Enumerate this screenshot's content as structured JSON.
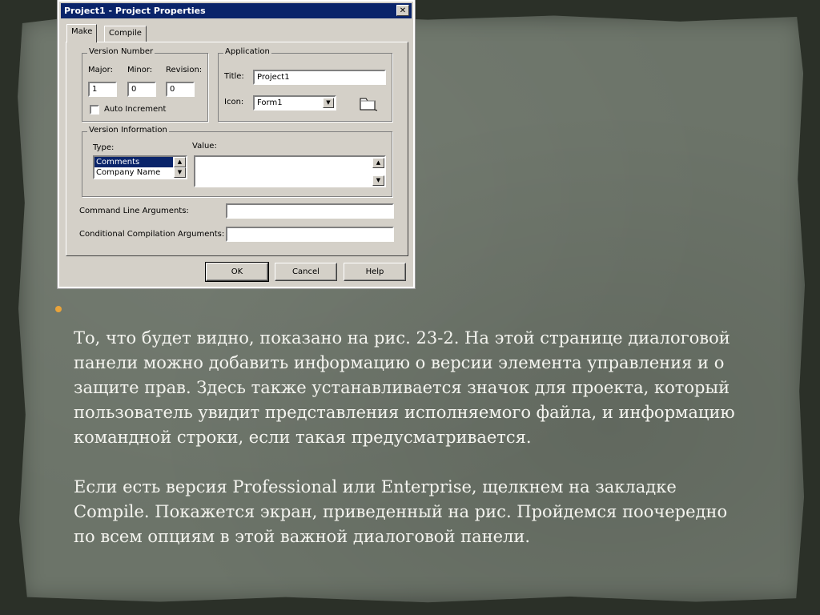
{
  "dialog": {
    "title": "Project1 - Project Properties",
    "close_glyph": "✕",
    "tabs": [
      {
        "label": "Make",
        "active": true
      },
      {
        "label": "Compile",
        "active": false
      }
    ],
    "version_number": {
      "group_label": "Version Number",
      "major_label": "Major:",
      "minor_label": "Minor:",
      "revision_label": "Revision:",
      "major_value": "1",
      "minor_value": "0",
      "revision_value": "0",
      "auto_increment_label": "Auto Increment",
      "auto_increment_checked": false
    },
    "application": {
      "group_label": "Application",
      "title_label": "Title:",
      "title_value": "Project1",
      "icon_label": "Icon:",
      "icon_value": "Form1",
      "icon_preview": "folder-icon"
    },
    "version_information": {
      "group_label": "Version Information",
      "type_label": "Type:",
      "value_label": "Value:",
      "types": [
        "Comments",
        "Company Name"
      ],
      "selected_type": "Comments",
      "value": ""
    },
    "command_line_label": "Command Line Arguments:",
    "command_line_value": "",
    "conditional_compilation_label": "Conditional Compilation Arguments:",
    "conditional_compilation_value": "",
    "buttons": {
      "ok": "OK",
      "cancel": "Cancel",
      "help": "Help"
    }
  },
  "slide": {
    "bullet_color": "#e9a33a",
    "paragraph_1": "    То, что будет видно, показано на рис. 23-2. На этой странице диалоговой\nпанели можно добавить информацию о версии элемента управления и о\nзащите прав. Здесь также устанавливается значок для проекта, который\nпользователь увидит представления исполняемого файла, и информацию\nкомандной строки, если такая предусматривается.",
    "paragraph_2": "    Если есть версия Professional или Enterprise, щелкнем на закладке\nCompile. Покажется экран, приведенный на рис. Пройдемся поочередно\nпо всем опциям в этой важной диалоговой панели."
  }
}
